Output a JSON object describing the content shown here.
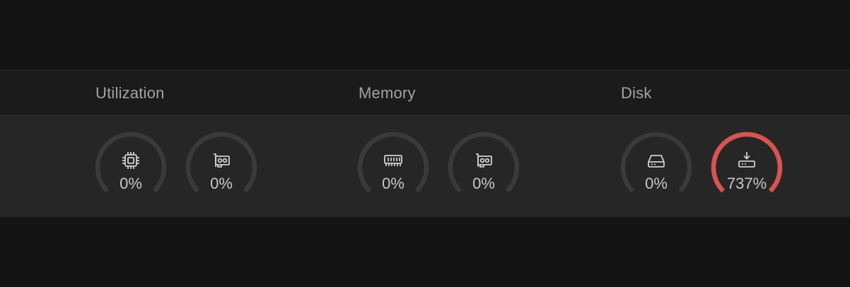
{
  "sections": {
    "utilization": {
      "title": "Utilization"
    },
    "memory": {
      "title": "Memory"
    },
    "disk": {
      "title": "Disk"
    }
  },
  "gauges": [
    {
      "name": "cpu-utilization",
      "icon": "cpu-icon",
      "value_text": "0%",
      "level": 0,
      "color": "#d9534f"
    },
    {
      "name": "gpu-utilization",
      "icon": "gpu-card-icon",
      "value_text": "0%",
      "level": 0,
      "color": "#d9534f"
    },
    {
      "name": "ram-memory",
      "icon": "ram-icon",
      "value_text": "0%",
      "level": 0,
      "color": "#d9534f"
    },
    {
      "name": "gpu-memory",
      "icon": "gpu-card-icon",
      "value_text": "0%",
      "level": 0,
      "color": "#d9534f"
    },
    {
      "name": "disk-usage",
      "icon": "hard-drive-icon",
      "value_text": "0%",
      "level": 0,
      "color": "#d9534f"
    },
    {
      "name": "disk-write",
      "icon": "download-drive-icon",
      "value_text": "737%",
      "level": 1,
      "color": "#d9534f"
    }
  ],
  "colors": {
    "track": "#3a3a3a",
    "alert": "#d9534f"
  }
}
